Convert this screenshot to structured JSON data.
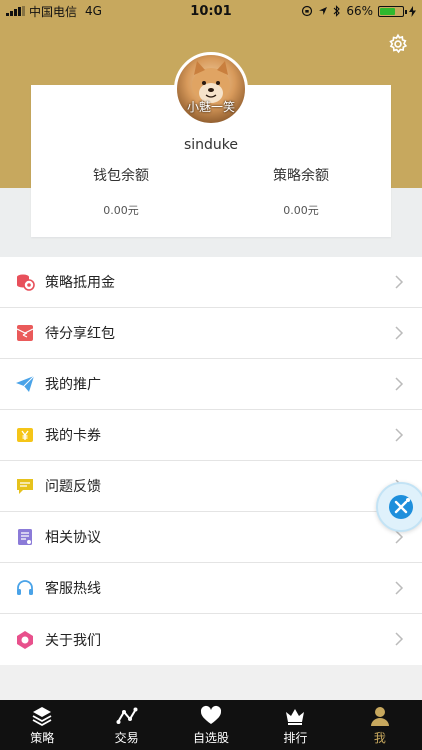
{
  "status_bar": {
    "carrier": "中国电信",
    "network": "4G",
    "time": "10:01",
    "battery": "66%",
    "battery_level": 0.66
  },
  "profile": {
    "avatar_caption": "小魅一笑",
    "username": "sinduke",
    "wallet_label": "钱包余额",
    "wallet_value": "0.00元",
    "strategy_label": "策略余额",
    "strategy_value": "0.00元"
  },
  "menu": {
    "items": [
      {
        "label": "策略抵用金",
        "icon": "coins-icon"
      },
      {
        "label": "待分享红包",
        "icon": "red-envelope-icon"
      },
      {
        "label": "我的推广",
        "icon": "paper-plane-icon"
      },
      {
        "label": "我的卡券",
        "icon": "coupon-icon"
      },
      {
        "label": "问题反馈",
        "icon": "feedback-icon"
      },
      {
        "label": "相关协议",
        "icon": "document-icon"
      },
      {
        "label": "客服热线",
        "icon": "headset-icon"
      },
      {
        "label": "关于我们",
        "icon": "about-icon"
      }
    ]
  },
  "tabs": [
    {
      "label": "策略",
      "icon": "layers-icon"
    },
    {
      "label": "交易",
      "icon": "trend-icon"
    },
    {
      "label": "自选股",
      "icon": "heart-icon"
    },
    {
      "label": "排行",
      "icon": "crown-icon"
    },
    {
      "label": "我",
      "icon": "person-icon",
      "active": true
    }
  ],
  "colors": {
    "accent_gold": "#c7a85e",
    "tab_bar": "#111111",
    "background": "#f0f0f0"
  }
}
